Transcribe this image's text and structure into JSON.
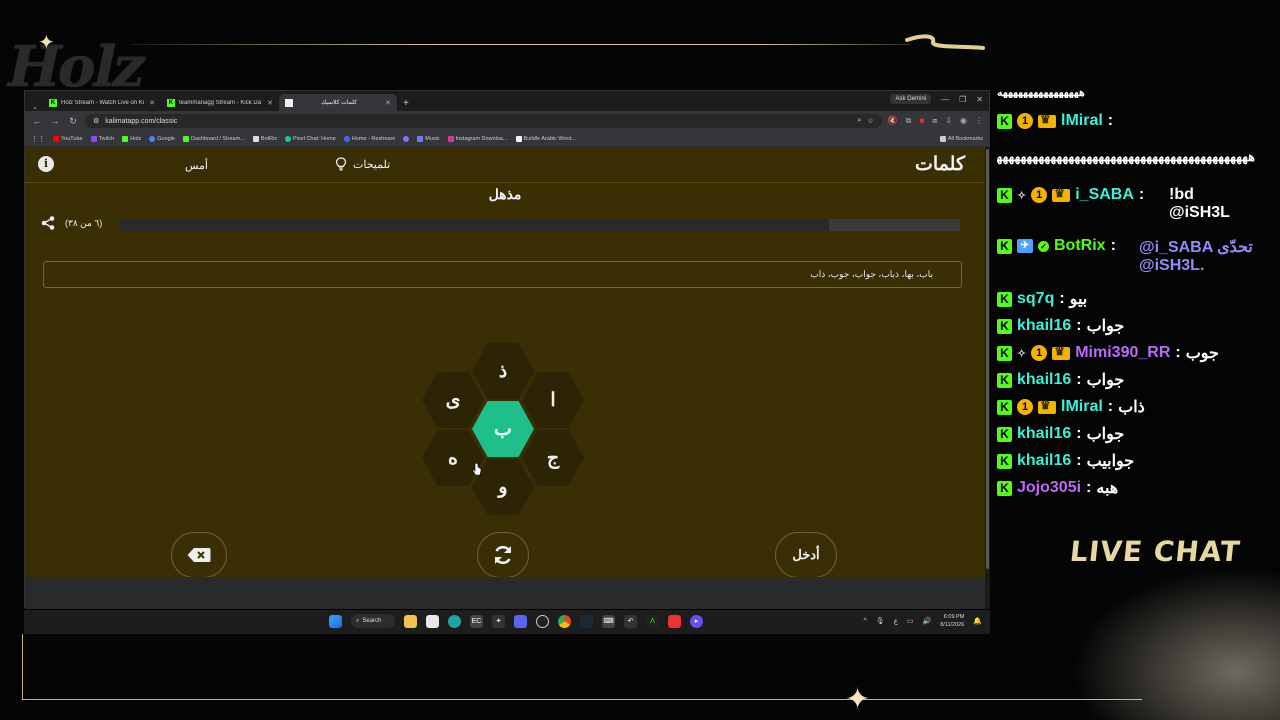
{
  "overlay": {
    "brand": "Holz",
    "live_chat_label": "LIVE CHAT"
  },
  "browser": {
    "tabs": [
      {
        "title": "Holz Stream - Watch Live on Ki",
        "icon": "kick-icon",
        "active": false
      },
      {
        "title": "teammanagg Stream - Kick Da",
        "icon": "kick-icon",
        "active": false
      },
      {
        "title": "كلمات كلاسيك",
        "icon": "doc-icon",
        "active": true
      }
    ],
    "new_tab": "+",
    "ask_gemini": "Ask Gemini",
    "url": "kalimatapp.com/classic",
    "bookmarks": [
      {
        "label": "YouTube",
        "color": "#ff0000"
      },
      {
        "label": "Twitch",
        "color": "#9146ff"
      },
      {
        "label": "Holz",
        "color": "#53fc18"
      },
      {
        "label": "Google",
        "color": "#4285f4"
      },
      {
        "label": "Dashboard / Stream...",
        "color": "#53fc18"
      },
      {
        "label": "BotRix",
        "color": "#dddddd"
      },
      {
        "label": "Pixel Chat: Home",
        "color": "#19c5a0"
      },
      {
        "label": "Home - Restream",
        "color": "#3a6df0"
      },
      {
        "label": "",
        "color": "#8a6df0"
      },
      {
        "label": "Music",
        "color": "#6d7cf0"
      },
      {
        "label": "Instagram Downloa...",
        "color": "#d13d8c"
      },
      {
        "label": "Buildle Arabic Word...",
        "color": "#f0f0f0"
      }
    ],
    "all_bookmarks": "All Bookmarks"
  },
  "game": {
    "title": "كلمات",
    "hints_label": "تلميحات",
    "yesterday_label": "أمس",
    "rank": "مذهل",
    "count": "(٦ من ٣٨)",
    "progress_fraction": 0.156,
    "found_words": "باب، بها، ذباب، جواب، جوب، ذاب",
    "center_letter": "ب",
    "outer_letters": [
      "ذ",
      "ا",
      "ج",
      "و",
      "ه",
      "ى"
    ],
    "enter_label": "أدخل",
    "center_color": "#1fbf8b",
    "bg_color": "#3a2e05"
  },
  "taskbar": {
    "search_label": "Search",
    "lang": "ع",
    "time": "6:09 PM",
    "date": "8/11/2026"
  },
  "chat": [
    {
      "user": "",
      "message": "ههههههههههههههههه",
      "user_color": "#ffffff",
      "badges": [],
      "partial": true
    },
    {
      "user": "lMiral",
      "message": "هههههههههههههههههههههههههههههههههههههههههههههه",
      "user_color": "#3df0d7",
      "badges": [
        "kick",
        "sub-1",
        "crown"
      ]
    },
    {
      "user": "i_SABA",
      "message": "!bd @iSH3L",
      "user_color": "#3df0d7",
      "badges": [
        "kick",
        "misc",
        "sub-1",
        "crown"
      ]
    },
    {
      "user": "BotRix",
      "message": "@i_SABA تحدّى @iSH3L.",
      "user_color": "#53fc18",
      "badges": [
        "kick",
        "bot",
        "verified"
      ]
    },
    {
      "user": "sq7q",
      "message": "بيو",
      "user_color": "#3df0d7",
      "badges": [
        "kick"
      ]
    },
    {
      "user": "khail16",
      "message": "جواب",
      "user_color": "#3df0d7",
      "badges": [
        "kick"
      ]
    },
    {
      "user": "Mimi390_RR",
      "message": "جوب",
      "user_color": "#b76cf5",
      "badges": [
        "kick",
        "misc",
        "sub-1",
        "crown"
      ]
    },
    {
      "user": "khail16",
      "message": "جواب",
      "user_color": "#3df0d7",
      "badges": [
        "kick"
      ]
    },
    {
      "user": "lMiral",
      "message": "ذاب",
      "user_color": "#3df0d7",
      "badges": [
        "kick",
        "sub-1",
        "crown"
      ]
    },
    {
      "user": "khail16",
      "message": "جواب",
      "user_color": "#3df0d7",
      "badges": [
        "kick"
      ]
    },
    {
      "user": "khail16",
      "message": "جوابيب",
      "user_color": "#3df0d7",
      "badges": [
        "kick"
      ]
    },
    {
      "user": "Jojo305i",
      "message": "هبه",
      "user_color": "#b76cf5",
      "badges": [
        "kick"
      ]
    }
  ]
}
